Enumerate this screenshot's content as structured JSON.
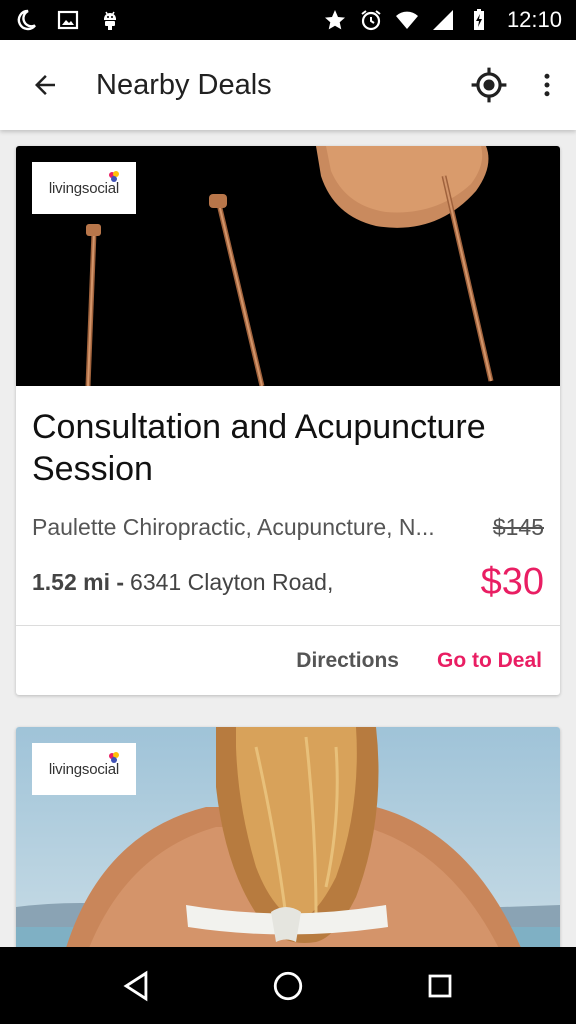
{
  "status_bar": {
    "time": "12:10",
    "icons": [
      "moon-icon",
      "image-icon",
      "android-icon",
      "star-icon",
      "alarm-icon",
      "wifi-icon",
      "signal-icon",
      "battery-charging-icon"
    ]
  },
  "app_bar": {
    "title": "Nearby Deals",
    "icons": [
      "back-arrow-icon",
      "my-location-icon",
      "more-vert-icon"
    ]
  },
  "deals": [
    {
      "brand": "livingsocial",
      "title": "Consultation and Acupuncture Session",
      "merchant": "Paulette Chiropractic, Acupuncture, N...",
      "original_price": "$145",
      "distance": "1.52 mi -",
      "address": "6341 Clayton Road,",
      "price": "$30",
      "actions": {
        "directions": "Directions",
        "go_to_deal": "Go to Deal"
      }
    },
    {
      "brand": "livingsocial"
    }
  ],
  "colors": {
    "accent": "#e91e63",
    "status_bar": "#000000",
    "app_bar": "#ffffff",
    "background": "#eeeeee"
  },
  "nav_bar": {
    "icons": [
      "back-triangle-icon",
      "home-circle-icon",
      "recents-square-icon"
    ]
  }
}
